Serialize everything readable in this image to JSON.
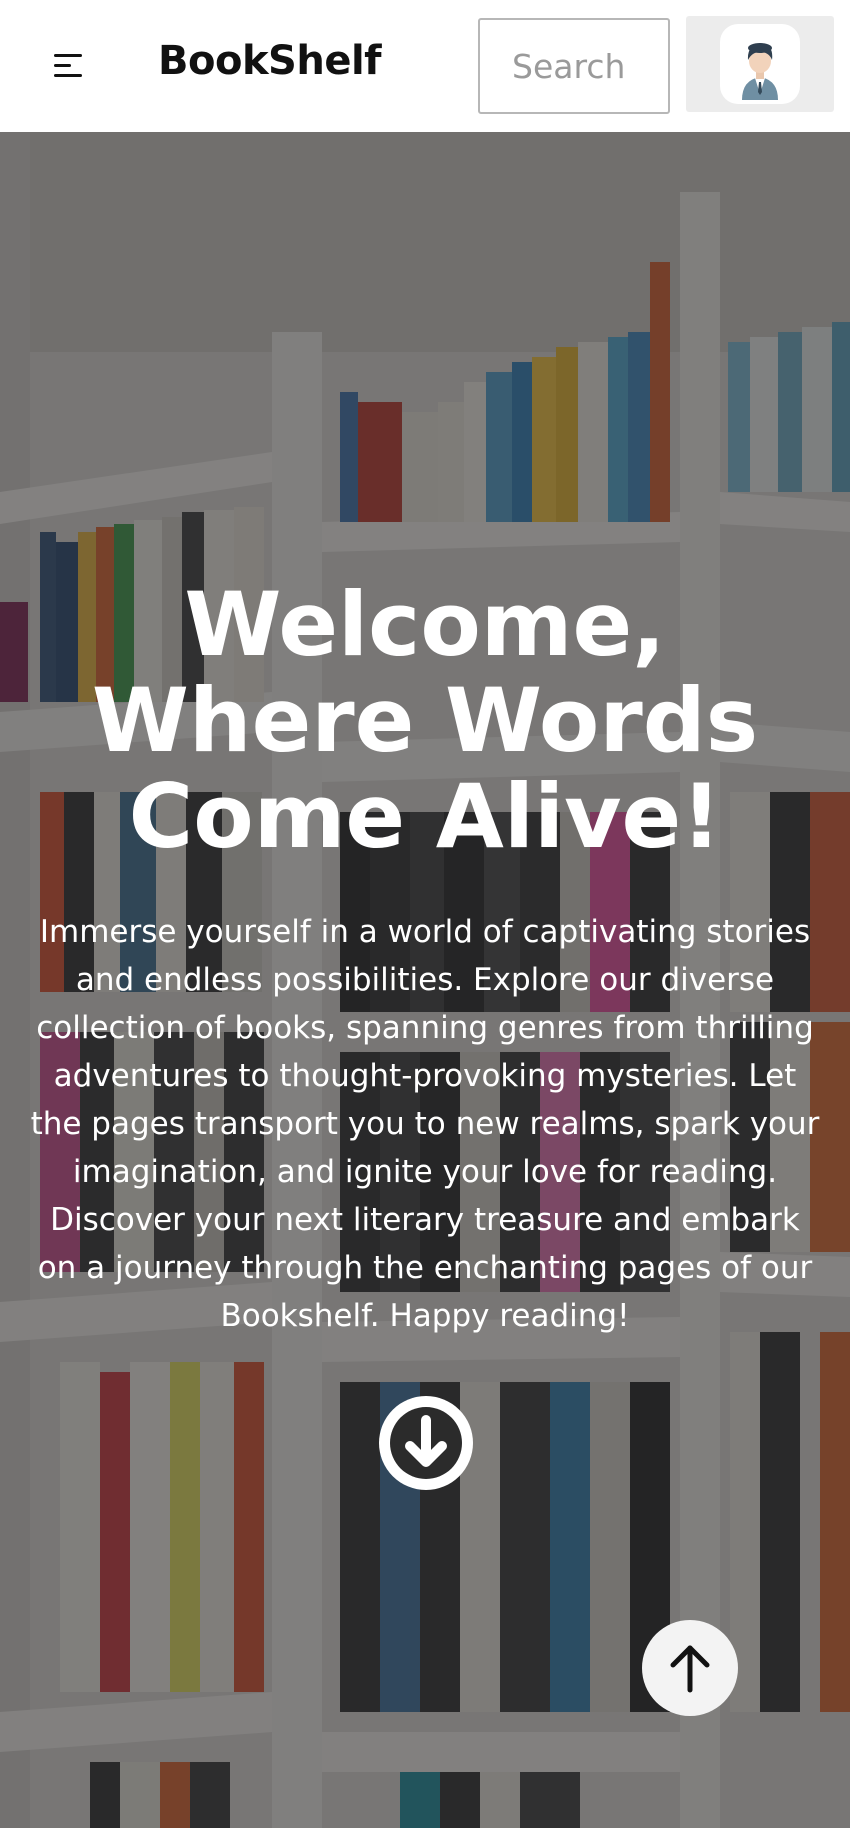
{
  "header": {
    "brand": "BookShelf",
    "search_placeholder": "Search",
    "menu_icon": "hamburger-menu-icon",
    "profile_icon": "user-avatar-icon"
  },
  "hero": {
    "title_line1": "Welcome,",
    "title_line2": "Where Words",
    "title_line3": "Come Alive!",
    "description": "Immerse yourself in a world of captivating stories and endless possibilities. Explore our diverse collection of books, spanning genres from thrilling adventures to thought-provoking mysteries. Let the pages transport you to new realms, spark your imagination, and ignite your love for reading. Discover your next literary treasure and embark on a journey through the enchanting pages of our Bookshelf. Happy reading!",
    "scroll_down_icon": "arrow-down-circle-icon",
    "background": "bookshelf-photo"
  },
  "scroll_top_icon": "arrow-up-icon",
  "colors": {
    "header_bg": "#ffffff",
    "brand": "#111111",
    "hero_overlay": "#28282a",
    "hero_text": "#ffffff"
  }
}
